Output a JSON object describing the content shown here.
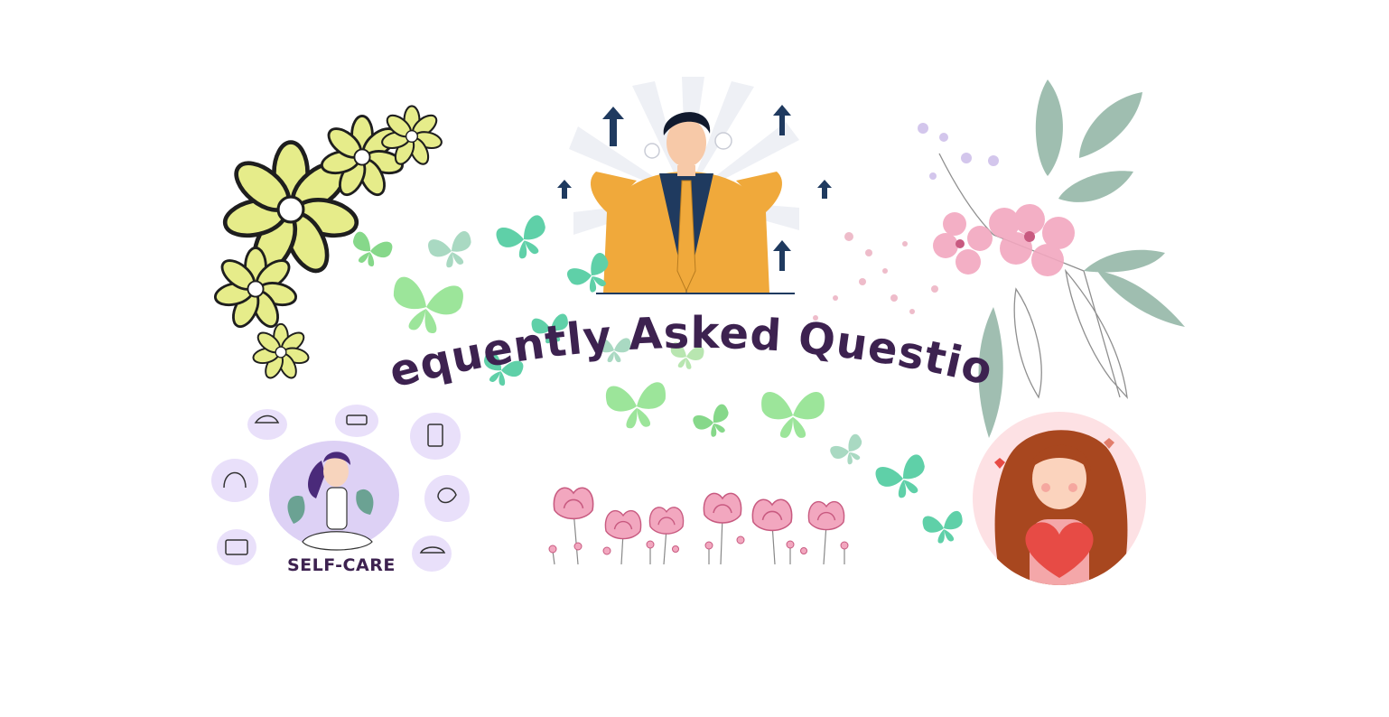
{
  "title": "Frequently Asked Questions",
  "self_care_label": "SELF-CARE",
  "colors": {
    "background": "#ffffff",
    "title": "#3d2250",
    "yellow_flower": "#e6ec8a",
    "flower_outline": "#1e1e1e",
    "butterfly_green": "#86d88a",
    "butterfly_teal": "#5fd0a8",
    "butterfly_pale": "#a9d9c2",
    "lavender": "#ddd1f5",
    "pink_flower": "#f2a7bf",
    "leaf_sage": "#8fb3a3",
    "suit_mustard": "#f0a93b",
    "navy": "#1f3a5f",
    "hair_brown": "#a8471f",
    "heart_red": "#e74b45"
  },
  "icons": [
    "daisy-cluster-icon",
    "butterfly-icon",
    "businessman-illustration",
    "watercolor-flower-bouquet",
    "self-care-illustration",
    "pink-flower-row",
    "girl-with-heart-illustration"
  ]
}
